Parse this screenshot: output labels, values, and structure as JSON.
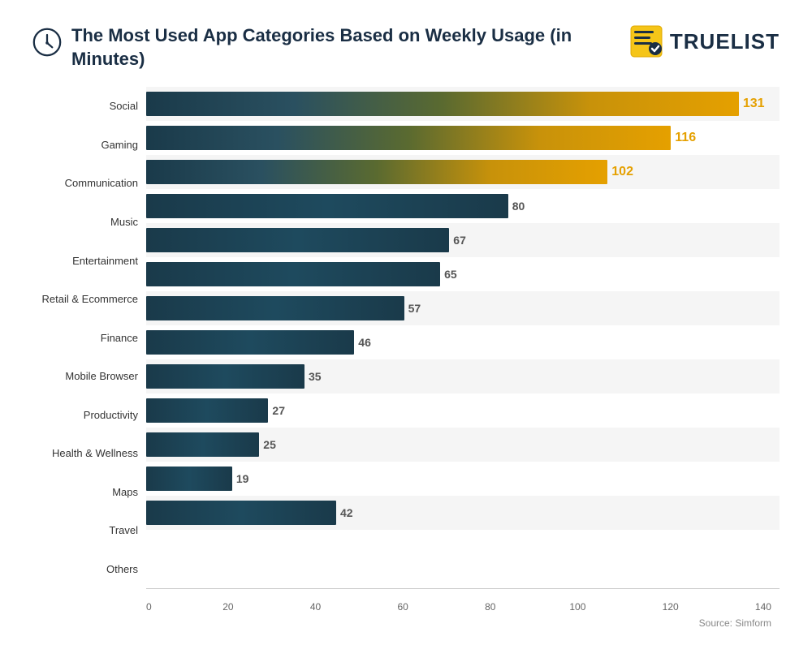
{
  "title": "The Most Used App Categories Based on Weekly Usage (in Minutes)",
  "logo": {
    "text": "TRUELIST"
  },
  "source": "Source: Simform",
  "max_value": 140,
  "chart": {
    "categories": [
      {
        "label": "Social",
        "value": 131,
        "is_top": true
      },
      {
        "label": "Gaming",
        "value": 116,
        "is_top": true
      },
      {
        "label": "Communication",
        "value": 102,
        "is_top": true
      },
      {
        "label": "Music",
        "value": 80,
        "is_top": false
      },
      {
        "label": "Entertainment",
        "value": 67,
        "is_top": false
      },
      {
        "label": "Retail & Ecommerce",
        "value": 65,
        "is_top": false
      },
      {
        "label": "Finance",
        "value": 57,
        "is_top": false
      },
      {
        "label": "Mobile Browser",
        "value": 46,
        "is_top": false
      },
      {
        "label": "Productivity",
        "value": 35,
        "is_top": false
      },
      {
        "label": "Health & Wellness",
        "value": 27,
        "is_top": false
      },
      {
        "label": "Maps",
        "value": 25,
        "is_top": false
      },
      {
        "label": "Travel",
        "value": 19,
        "is_top": false
      },
      {
        "label": "Others",
        "value": 42,
        "is_top": false
      }
    ],
    "x_ticks": [
      "0",
      "20",
      "40",
      "60",
      "80",
      "100",
      "120",
      "140"
    ]
  }
}
